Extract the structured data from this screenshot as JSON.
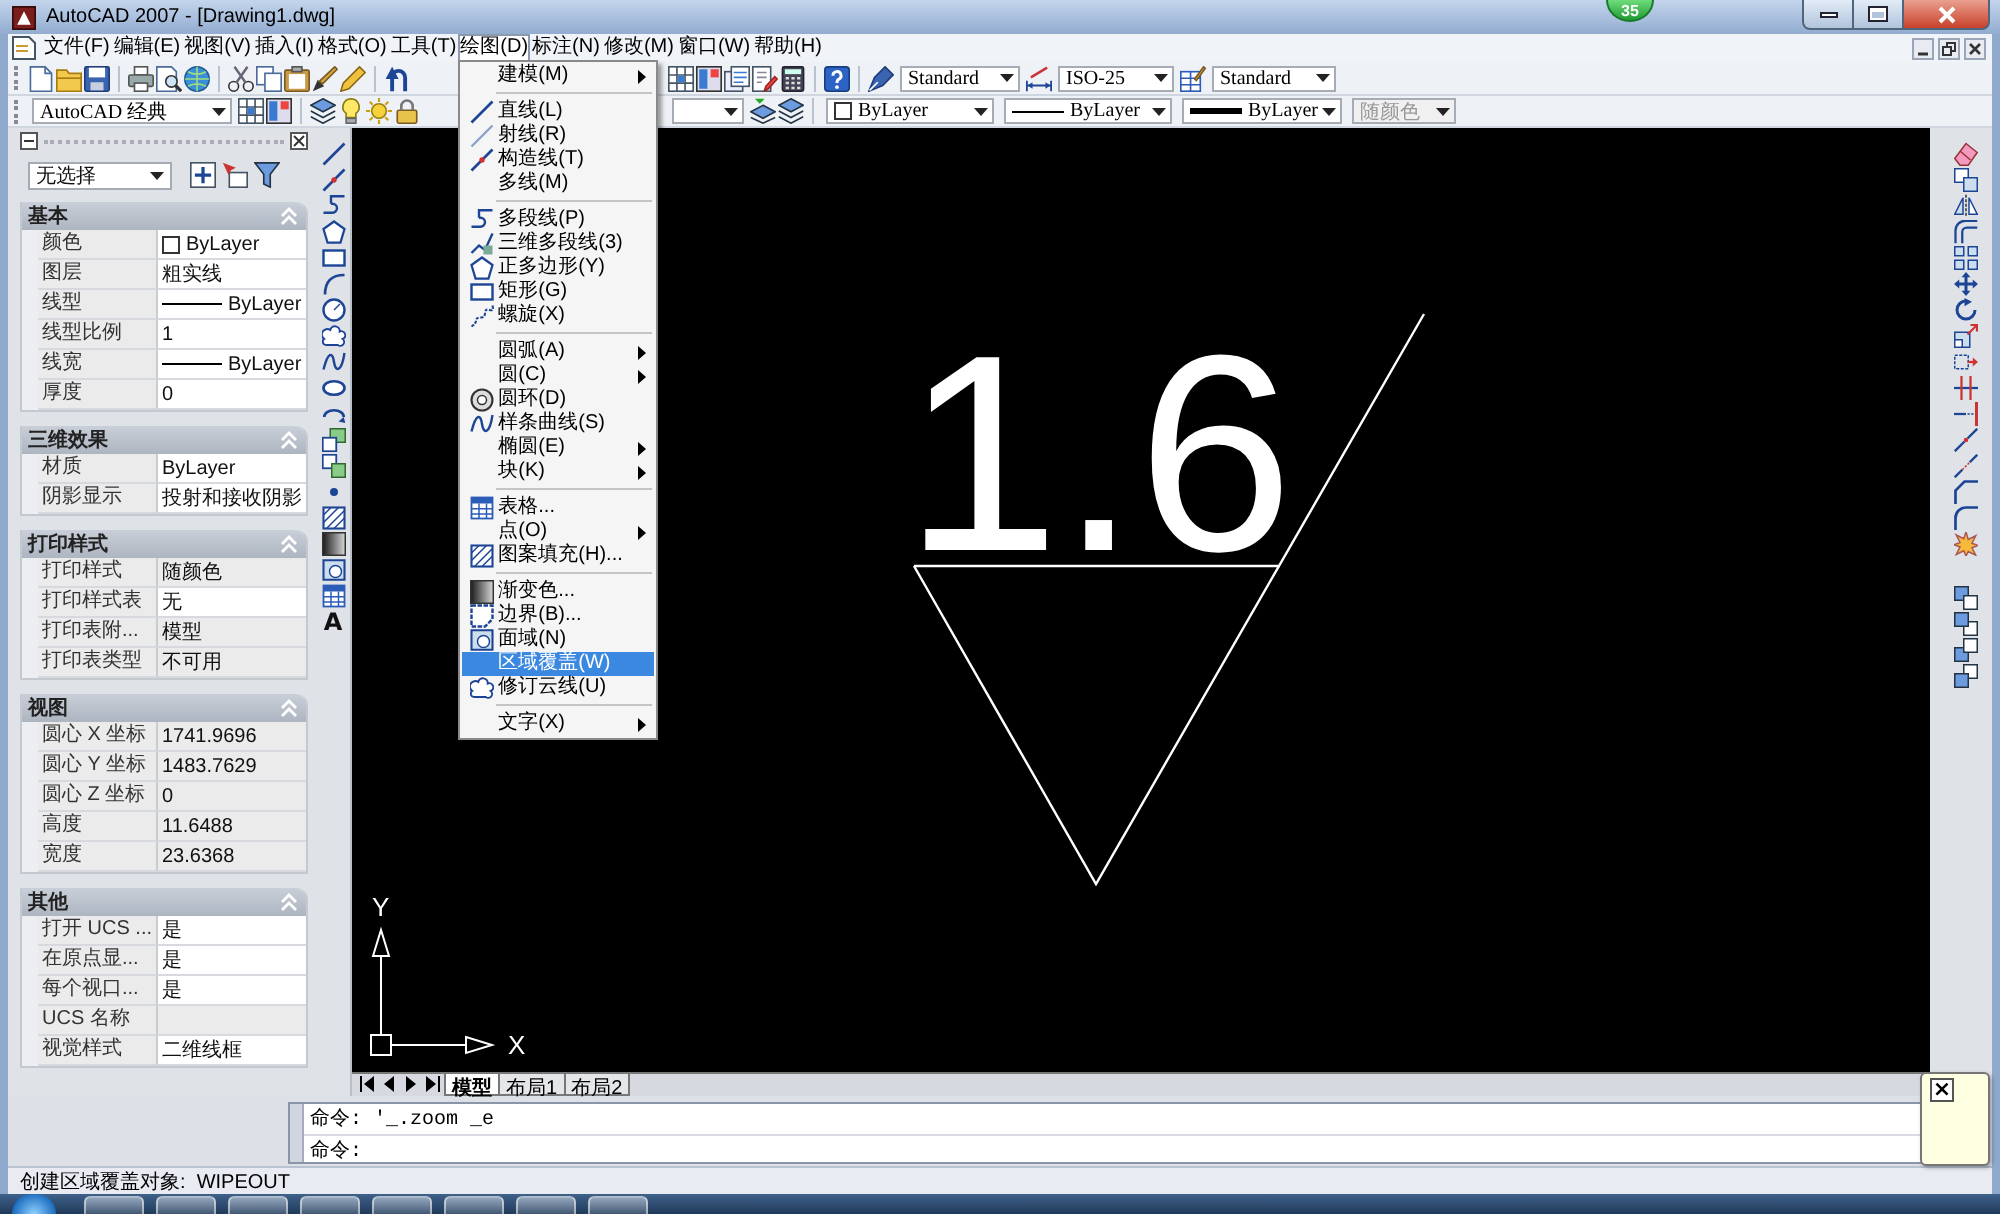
{
  "window": {
    "title": "AutoCAD 2007 - [Drawing1.dwg]"
  },
  "count_badge": "35",
  "menu_bar": [
    {
      "label": "文件(F)",
      "selected": false
    },
    {
      "label": "编辑(E)",
      "selected": false
    },
    {
      "label": "视图(V)",
      "selected": false
    },
    {
      "label": "插入(I)",
      "selected": false
    },
    {
      "label": "格式(O)",
      "selected": false
    },
    {
      "label": "工具(T)",
      "selected": false
    },
    {
      "label": "绘图(D)",
      "selected": true
    },
    {
      "label": "标注(N)",
      "selected": false
    },
    {
      "label": "修改(M)",
      "selected": false
    },
    {
      "label": "窗口(W)",
      "selected": false
    },
    {
      "label": "帮助(H)",
      "selected": false
    }
  ],
  "draw_menu": {
    "sections": [
      {
        "items": [
          {
            "label": "建模(M)",
            "has_icon": false,
            "submenu": true,
            "selected": false
          }
        ]
      },
      {
        "items": [
          {
            "label": "直线(L)",
            "has_icon": true,
            "submenu": false,
            "selected": false
          },
          {
            "label": "射线(R)",
            "has_icon": true,
            "submenu": false,
            "selected": false
          },
          {
            "label": "构造线(T)",
            "has_icon": true,
            "submenu": false,
            "selected": false
          },
          {
            "label": "多线(M)",
            "has_icon": false,
            "submenu": false,
            "selected": false
          }
        ]
      },
      {
        "items": [
          {
            "label": "多段线(P)",
            "has_icon": true,
            "submenu": false,
            "selected": false
          },
          {
            "label": "三维多段线(3)",
            "has_icon": true,
            "submenu": false,
            "selected": false
          },
          {
            "label": "正多边形(Y)",
            "has_icon": true,
            "submenu": false,
            "selected": false
          },
          {
            "label": "矩形(G)",
            "has_icon": true,
            "submenu": false,
            "selected": false
          },
          {
            "label": "螺旋(X)",
            "has_icon": true,
            "submenu": false,
            "selected": false
          }
        ]
      },
      {
        "items": [
          {
            "label": "圆弧(A)",
            "has_icon": false,
            "submenu": true,
            "selected": false
          },
          {
            "label": "圆(C)",
            "has_icon": false,
            "submenu": true,
            "selected": false
          },
          {
            "label": "圆环(D)",
            "has_icon": true,
            "submenu": false,
            "selected": false
          },
          {
            "label": "样条曲线(S)",
            "has_icon": true,
            "submenu": false,
            "selected": false
          },
          {
            "label": "椭圆(E)",
            "has_icon": false,
            "submenu": true,
            "selected": false
          },
          {
            "label": "块(K)",
            "has_icon": false,
            "submenu": true,
            "selected": false
          }
        ]
      },
      {
        "items": [
          {
            "label": "表格...",
            "has_icon": true,
            "submenu": false,
            "selected": false
          },
          {
            "label": "点(O)",
            "has_icon": false,
            "submenu": true,
            "selected": false
          },
          {
            "label": "图案填充(H)...",
            "has_icon": true,
            "submenu": false,
            "selected": false
          }
        ]
      },
      {
        "items": [
          {
            "label": "渐变色...",
            "has_icon": true,
            "submenu": false,
            "selected": false
          },
          {
            "label": "边界(B)...",
            "has_icon": true,
            "submenu": false,
            "selected": false
          },
          {
            "label": "面域(N)",
            "has_icon": true,
            "submenu": false,
            "selected": false
          },
          {
            "label": "区域覆盖(W)",
            "has_icon": false,
            "submenu": false,
            "selected": true
          },
          {
            "label": "修订云线(U)",
            "has_icon": true,
            "submenu": false,
            "selected": false
          }
        ]
      },
      {
        "items": [
          {
            "label": "文字(X)",
            "has_icon": false,
            "submenu": true,
            "selected": false
          }
        ]
      }
    ]
  },
  "standard_toolbar": {
    "text_style": "Standard",
    "dimension_style": "ISO-25",
    "table_style": "Standard"
  },
  "properties_toolbar": {
    "workspace": "AutoCAD 经典",
    "color_setting": "ByLayer",
    "linetype": "ByLayer",
    "lineweight": "ByLayer",
    "plot_style": {
      "value": "随颜色",
      "disabled": true
    }
  },
  "properties_palette": {
    "selection": "无选择",
    "sections": [
      {
        "title": "基本",
        "expanded": true,
        "rows": [
          {
            "label": "颜色",
            "value": "ByLayer",
            "kind": "swatch",
            "readonly": false
          },
          {
            "label": "图层",
            "value": "粗实线",
            "kind": "text",
            "readonly": false
          },
          {
            "label": "线型",
            "value": "ByLayer",
            "kind": "line",
            "readonly": false
          },
          {
            "label": "线型比例",
            "value": "1",
            "kind": "text",
            "readonly": false
          },
          {
            "label": "线宽",
            "value": "ByLayer",
            "kind": "line",
            "readonly": false
          },
          {
            "label": "厚度",
            "value": "0",
            "kind": "text",
            "readonly": false
          }
        ]
      },
      {
        "title": "三维效果",
        "expanded": true,
        "rows": [
          {
            "label": "材质",
            "value": "ByLayer",
            "kind": "text",
            "readonly": false
          },
          {
            "label": "阴影显示",
            "value": "投射和接收阴影",
            "kind": "text",
            "readonly": false
          }
        ]
      },
      {
        "title": "打印样式",
        "expanded": true,
        "rows": [
          {
            "label": "打印样式",
            "value": "随颜色",
            "kind": "text",
            "readonly": true
          },
          {
            "label": "打印样式表",
            "value": "无",
            "kind": "text",
            "readonly": false
          },
          {
            "label": "打印表附...",
            "value": "模型",
            "kind": "text",
            "readonly": true
          },
          {
            "label": "打印表类型",
            "value": "不可用",
            "kind": "text",
            "readonly": true
          }
        ]
      },
      {
        "title": "视图",
        "expanded": true,
        "rows": [
          {
            "label": "圆心 X 坐标",
            "value": "1741.9696",
            "kind": "text",
            "readonly": true
          },
          {
            "label": "圆心 Y 坐标",
            "value": "1483.7629",
            "kind": "text",
            "readonly": true
          },
          {
            "label": "圆心 Z 坐标",
            "value": "0",
            "kind": "text",
            "readonly": true
          },
          {
            "label": "高度",
            "value": "11.6488",
            "kind": "text",
            "readonly": true
          },
          {
            "label": "宽度",
            "value": "23.6368",
            "kind": "text",
            "readonly": true
          }
        ]
      },
      {
        "title": "其他",
        "expanded": true,
        "rows": [
          {
            "label": "打开 UCS ...",
            "value": "是",
            "kind": "text",
            "readonly": false
          },
          {
            "label": "在原点显...",
            "value": "是",
            "kind": "text",
            "readonly": false
          },
          {
            "label": "每个视口...",
            "value": "是",
            "kind": "text",
            "readonly": false
          },
          {
            "label": "UCS 名称",
            "kind": "text",
            "readonly": true
          },
          {
            "label": "视觉样式",
            "value": "二维线框",
            "kind": "text",
            "readonly": false
          }
        ]
      }
    ]
  },
  "draw_toolbar": {
    "text_tool": "A"
  },
  "drawing": {
    "annotation": "1.6",
    "ucs": {
      "x_label": "X",
      "y_label": "Y"
    }
  },
  "layout_tabs": [
    {
      "label": "模型",
      "selected": true
    },
    {
      "label": "布局1",
      "selected": false
    },
    {
      "label": "布局2",
      "selected": false
    }
  ],
  "command_window": {
    "history": [
      "命令: '_.zoom _e"
    ],
    "prompt": "命令:"
  },
  "status_bar": {
    "text": "创建区域覆盖对象:  WIPEOUT"
  },
  "notification": {
    "close": "×"
  }
}
